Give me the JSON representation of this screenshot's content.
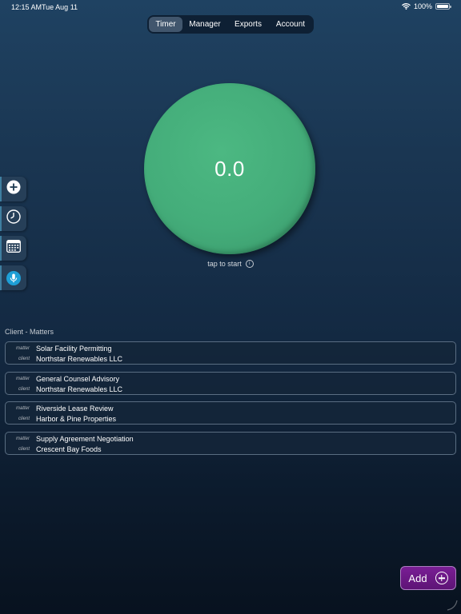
{
  "status_bar": {
    "time": "12:15 AM",
    "date": "Tue Aug 11",
    "battery": "100%",
    "icons": [
      "wifi-icon",
      "battery-icon"
    ]
  },
  "tabs": {
    "items": [
      {
        "label": "Timer",
        "active": true
      },
      {
        "label": "Manager",
        "active": false
      },
      {
        "label": "Exports",
        "active": false
      },
      {
        "label": "Account",
        "active": false
      }
    ]
  },
  "timer": {
    "value": "0.0",
    "hint": "tap to start",
    "hint_icon": "info-icon",
    "color": "#44ad7a"
  },
  "side_tools": [
    {
      "icon": "plus-circle-icon"
    },
    {
      "icon": "clock-icon"
    },
    {
      "icon": "calendar-icon"
    },
    {
      "icon": "microphone-icon",
      "color": "#1e9fd6"
    }
  ],
  "matters": {
    "section_label": "Client - Matters",
    "key_matter": "matter",
    "key_client": "client",
    "items": [
      {
        "matter": "Solar Facility Permitting",
        "client": "Northstar Renewables LLC"
      },
      {
        "matter": "General Counsel Advisory",
        "client": "Northstar Renewables LLC"
      },
      {
        "matter": "Riverside Lease Review",
        "client": "Harbor & Pine Properties"
      },
      {
        "matter": "Supply Agreement Negotiation",
        "client": "Crescent Bay Foods"
      }
    ]
  },
  "add_button": {
    "label": "Add",
    "icon": "plus-circle-icon",
    "color": "#6a1884"
  },
  "colors": {
    "background_top": "#1f4262",
    "background_bottom": "#08121f",
    "accent_green": "#44ad7a",
    "accent_purple": "#6a1884",
    "accent_blue": "#1e9fd6"
  }
}
